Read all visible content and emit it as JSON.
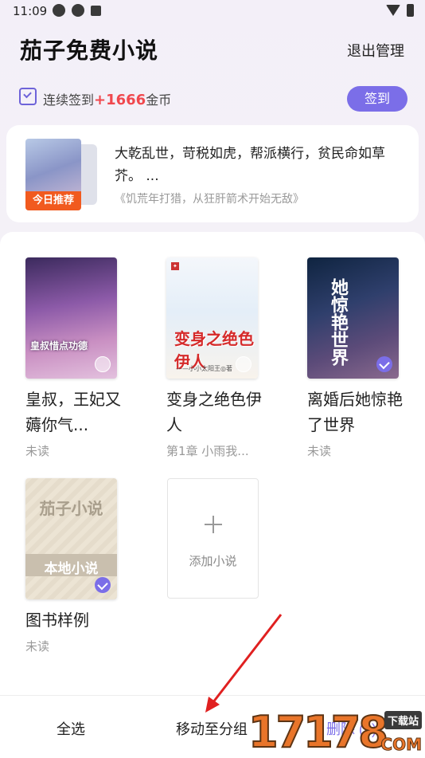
{
  "status_bar": {
    "time": "11:09"
  },
  "header": {
    "title": "茄子免费小说",
    "exit_manage": "退出管理"
  },
  "checkin": {
    "prefix": "连续签到",
    "coins": "+1666",
    "suffix": "金币",
    "button": "签到"
  },
  "recommend": {
    "badge": "今日推荐",
    "description": "大乾乱世，苛税如虎，帮派横行，贫民命如草芥。 ...",
    "source": "《饥荒年打猎，从狂肝箭术开始无敌》"
  },
  "books": [
    {
      "title": "皇叔，王妃又薅你气...",
      "progress": "未读",
      "cover_text": "皇叔惜点功德",
      "selected": false
    },
    {
      "title": "变身之绝色伊人",
      "progress": "第1章 小雨我...",
      "cover_text": "变身之绝色伊人",
      "cover_author": "——小小太阳王◎著",
      "selected": false
    },
    {
      "title": "离婚后她惊艳了世界",
      "progress": "未读",
      "cover_text": "她惊艳世界",
      "selected": true
    },
    {
      "title": "图书样例",
      "progress": "未读",
      "cover_text_top": "茄子小说",
      "cover_text_band": "本地小说",
      "selected": true
    }
  ],
  "add_book": {
    "label": "添加小说"
  },
  "bottom_bar": {
    "select_all": "全选",
    "move_group": "移动至分组",
    "delete": "删除 (2)"
  },
  "watermark": {
    "number": "17178",
    "tag": "下载站",
    "domain": "COM"
  },
  "colors": {
    "accent": "#7b6ee8",
    "coins_red": "#f0484e",
    "badge_orange": "#f15a1f"
  }
}
